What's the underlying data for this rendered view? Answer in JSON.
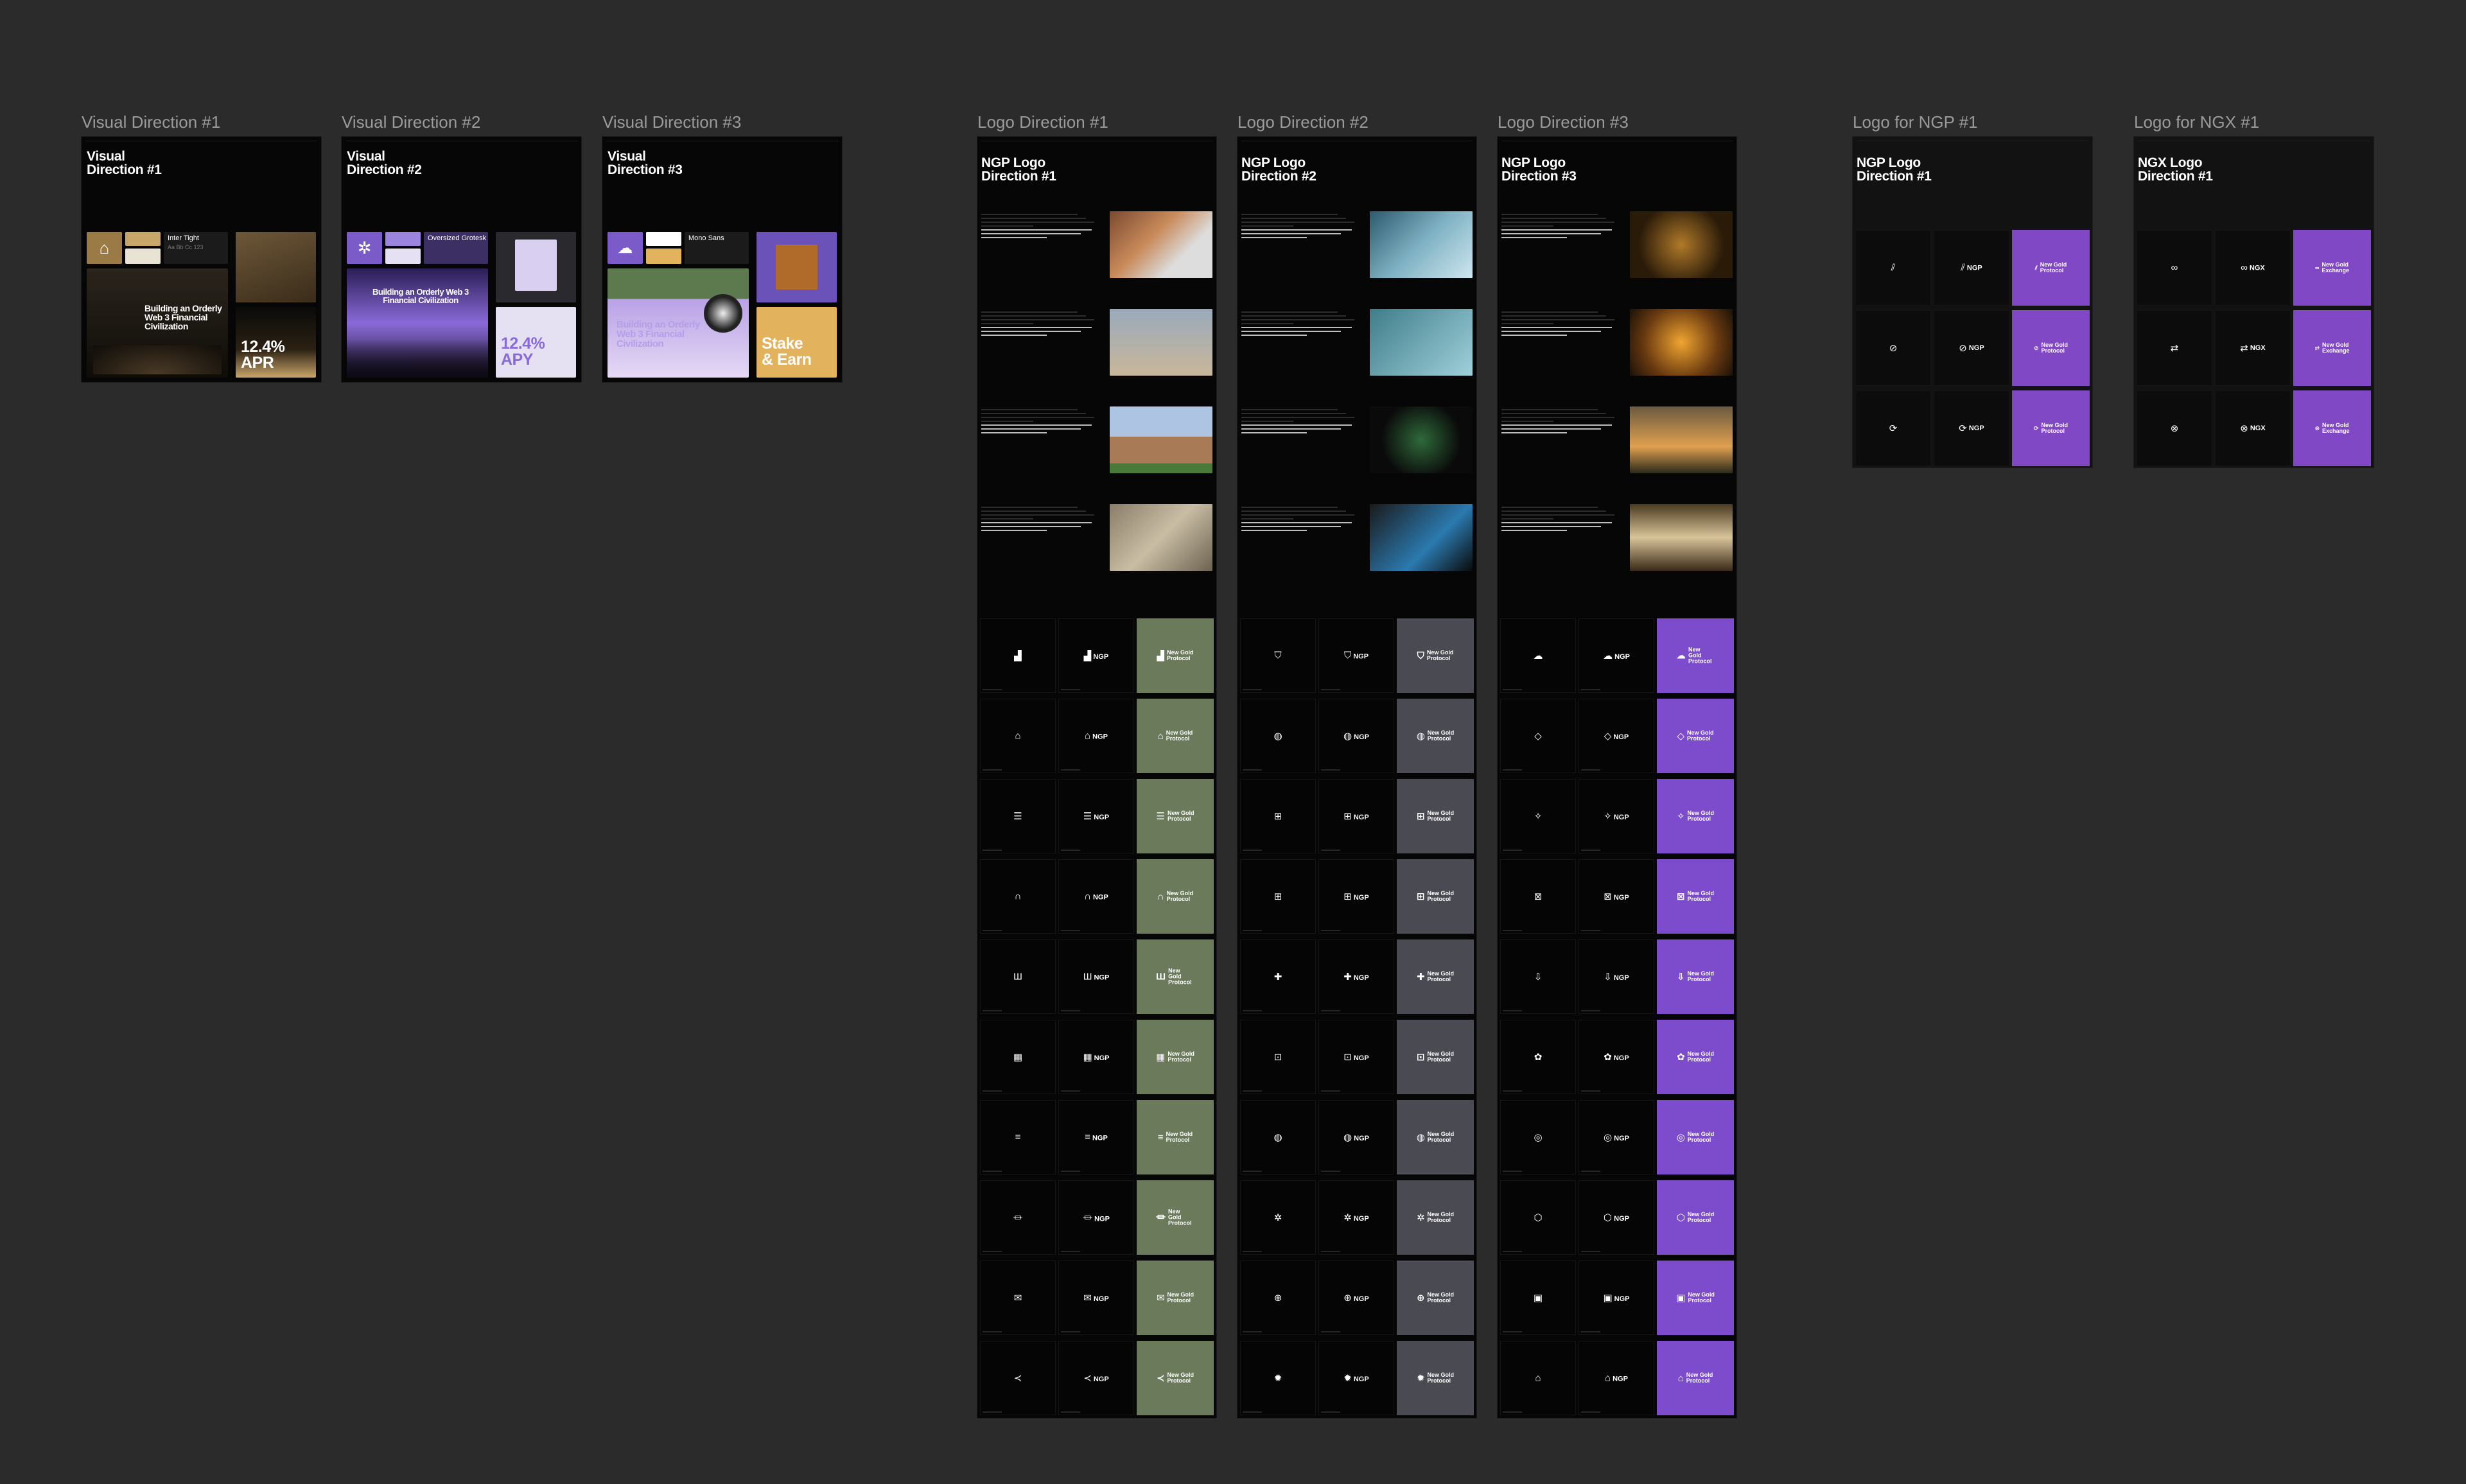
{
  "canvas": {
    "background": "#2b2b2b"
  },
  "visual_directions": [
    {
      "label": "Visual Direction #1",
      "title": "Visual\nDirection #1",
      "font_name": "Inter Tight",
      "hero_text": "Building an Orderly\nWeb 3 Financial\nCivilization",
      "stat": "12.4%\nAPR",
      "palette": [
        "#9a7a45",
        "#e9e3d6",
        "#1a1a1a"
      ]
    },
    {
      "label": "Visual Direction #2",
      "title": "Visual\nDirection #2",
      "font_name": "Oversized Grotesk",
      "hero_text": "Building an Orderly Web 3\nFinancial Civilization",
      "stat": "12.4%\nAPY",
      "palette": [
        "#7a5bc7",
        "#e6e0f3",
        "#1a1a1a"
      ]
    },
    {
      "label": "Visual Direction #3",
      "title": "Visual\nDirection #3",
      "font_name": "Mono Sans",
      "hero_text": "Building an Orderly\nWeb 3 Financial\nCivilization",
      "stat": "Stake\n& Earn",
      "palette": [
        "#7a5bc7",
        "#ffffff",
        "#e3b25d"
      ]
    }
  ],
  "logo_directions": [
    {
      "label": "Logo Direction #1",
      "title": "NGP Logo\nDirection #1",
      "accent": "#6a7a5a"
    },
    {
      "label": "Logo Direction #2",
      "title": "NGP Logo\nDirection #2",
      "accent": "#4a4a52"
    },
    {
      "label": "Logo Direction #3",
      "title": "NGP Logo\nDirection #3",
      "accent": "#7d4ccd"
    }
  ],
  "logo_pages": [
    {
      "label": "Logo for NGP #1",
      "title": "NGP Logo\nDirection #1",
      "wordmark": "NGP",
      "brand_name": "New Gold\nProtocol",
      "accent": "#8048c4"
    },
    {
      "label": "Logo for NGX #1",
      "title": "NGX Logo\nDirection #1",
      "wordmark": "NGX",
      "brand_name": "New Gold\nExchange",
      "accent": "#8048c4"
    }
  ],
  "logo_wordmark": "NGP",
  "logo_brand_name": "New Gold\nProtocol",
  "icons": {
    "dir1": [
      "bar-chart-icon",
      "house-arch-icon",
      "stairs-icon",
      "arch-icon",
      "pillars-icon",
      "building-icon",
      "layers-icon",
      "bank-icon",
      "envelope-icon",
      "wind-icon"
    ],
    "dir2": [
      "shield-icon",
      "globe-icon",
      "plus-square-icon",
      "plus-square-icon",
      "plus-badge-icon",
      "chain-icon",
      "globe-icon",
      "gear-icon",
      "plus-circle-icon",
      "sun-icon"
    ],
    "dir3": [
      "cloud-icon",
      "diamond-icon",
      "sparkle-icon",
      "grid-icon",
      "arrow-down-icon",
      "flower-icon",
      "ring-icon",
      "gem-icon",
      "image-icon",
      "house-icon"
    ],
    "ngp": [
      "slashes-icon",
      "blocked-icon",
      "loop-icon"
    ],
    "ngx": [
      "double-ring-icon",
      "swap-icon",
      "x-circle-icon"
    ]
  },
  "glyphs": {
    "bar-chart-icon": "▟",
    "house-arch-icon": "⌂",
    "stairs-icon": "☰",
    "arch-icon": "∩",
    "pillars-icon": "Ш",
    "building-icon": "▦",
    "layers-icon": "≡",
    "bank-icon": "⏛",
    "envelope-icon": "✉",
    "wind-icon": "≺",
    "shield-icon": "⛉",
    "globe-icon": "◍",
    "plus-square-icon": "⊞",
    "plus-badge-icon": "✚",
    "chain-icon": "⊡",
    "gear-icon": "✲",
    "plus-circle-icon": "⊕",
    "sun-icon": "✹",
    "cloud-icon": "☁",
    "diamond-icon": "◇",
    "sparkle-icon": "✧",
    "grid-icon": "⊠",
    "arrow-down-icon": "⇩",
    "flower-icon": "✿",
    "ring-icon": "◎",
    "gem-icon": "⬡",
    "image-icon": "▣",
    "house-icon": "⌂",
    "slashes-icon": "⫽",
    "blocked-icon": "⊘",
    "loop-icon": "⟳",
    "double-ring-icon": "∞",
    "swap-icon": "⇄",
    "x-circle-icon": "⊗"
  }
}
